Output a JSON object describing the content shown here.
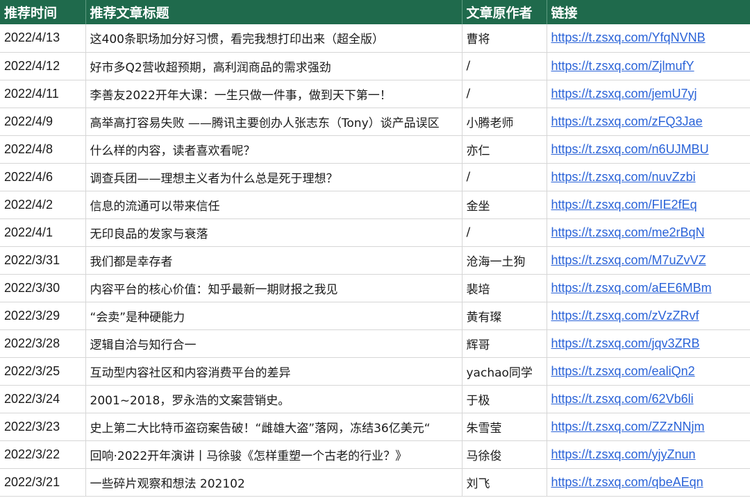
{
  "table": {
    "headers": {
      "date": "推荐时间",
      "title": "推荐文章标题",
      "author": "文章原作者",
      "link": "链接"
    },
    "rows": [
      {
        "date": "2022/4/13",
        "title": "这400条职场加分好习惯，看完我想打印出来（超全版）",
        "author": "曹将",
        "link": "https://t.zsxq.com/YfqNVNB"
      },
      {
        "date": "2022/4/12",
        "title": "好市多Q2营收超预期，高利润商品的需求强劲",
        "author": "/",
        "link": "https://t.zsxq.com/ZjlmufY"
      },
      {
        "date": "2022/4/11",
        "title": "李善友2022开年大课：一生只做一件事，做到天下第一！",
        "author": "/",
        "link": "https://t.zsxq.com/jemU7yj"
      },
      {
        "date": "2022/4/9",
        "title": "高举高打容易失败 ——腾讯主要创办人张志东（Tony）谈产品误区",
        "author": "小腾老师",
        "link": "https://t.zsxq.com/zFQ3Jae"
      },
      {
        "date": "2022/4/8",
        "title": "什么样的内容，读者喜欢看呢？",
        "author": "亦仁",
        "link": "https://t.zsxq.com/n6UJMBU"
      },
      {
        "date": "2022/4/6",
        "title": "调查兵团——理想主义者为什么总是死于理想？",
        "author": "/",
        "link": "https://t.zsxq.com/nuvZzbi"
      },
      {
        "date": "2022/4/2",
        "title": "信息的流通可以带来信任",
        "author": "金坐",
        "link": "https://t.zsxq.com/FIE2fEq"
      },
      {
        "date": "2022/4/1",
        "title": "无印良品的发家与衰落",
        "author": "/",
        "link": "https://t.zsxq.com/me2rBqN"
      },
      {
        "date": "2022/3/31",
        "title": "我们都是幸存者",
        "author": "沧海一土狗",
        "link": "https://t.zsxq.com/M7uZvVZ"
      },
      {
        "date": "2022/3/30",
        "title": "内容平台的核心价值：知乎最新一期财报之我见",
        "author": "裴培",
        "link": "https://t.zsxq.com/aEE6MBm"
      },
      {
        "date": "2022/3/29",
        "title": "“会卖”是种硬能力",
        "author": "黄有璨",
        "link": "https://t.zsxq.com/zVzZRvf"
      },
      {
        "date": "2022/3/28",
        "title": "逻辑自洽与知行合一",
        "author": "辉哥",
        "link": "https://t.zsxq.com/jqv3ZRB"
      },
      {
        "date": "2022/3/25",
        "title": "互动型内容社区和内容消费平台的差异",
        "author": "yachao同学",
        "link": "https://t.zsxq.com/ealiQn2"
      },
      {
        "date": "2022/3/24",
        "title": "2001~2018，罗永浩的文案营销史。",
        "author": "于极",
        "link": "https://t.zsxq.com/62Vb6li"
      },
      {
        "date": "2022/3/23",
        "title": "史上第二大比特币盗窃案告破！“雌雄大盗”落网，冻结36亿美元“",
        "author": "朱雪莹",
        "link": "https://t.zsxq.com/ZZzNNjm"
      },
      {
        "date": "2022/3/22",
        "title": "回响·2022开年演讲丨马徐骏《怎样重塑一个古老的行业？》",
        "author": "马徐俊",
        "link": "https://t.zsxq.com/yjyZnun"
      },
      {
        "date": "2022/3/21",
        "title": "一些碎片观察和想法 202102",
        "author": "刘飞",
        "link": "https://t.zsxq.com/qbeAEqn"
      }
    ]
  },
  "colors": {
    "header_bg": "#1f6a4c",
    "header_text": "#ffffff",
    "link": "#2a63d8",
    "grid": "#d6d6d6"
  }
}
